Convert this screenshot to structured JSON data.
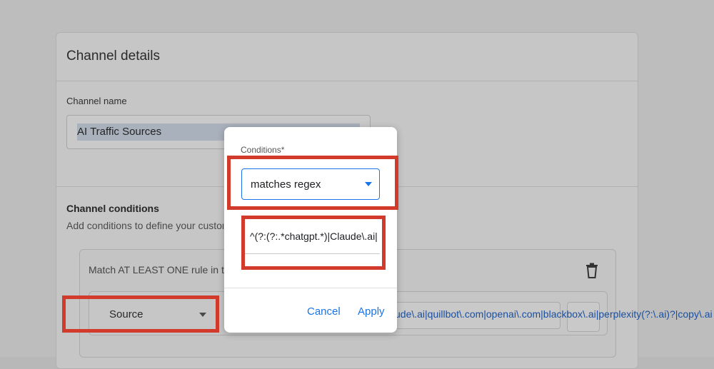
{
  "channel_details": {
    "title": "Channel details",
    "name_label": "Channel name",
    "name_value": "AI Traffic Sources",
    "conditions_heading": "Channel conditions",
    "conditions_hint": "Add conditions to define your custom channel.",
    "rule_group_text": "Match AT LEAST ONE rule in this group",
    "dimension": "Source",
    "regex_overflow": "ude\\.ai|quillbot\\.com|openai\\.com|blackbox\\.ai|perplexity(?:\\.ai)?|copy\\.ai"
  },
  "dialog": {
    "label": "Conditions*",
    "operator": "matches regex",
    "regex_value": "^(?:(?:.*chatgpt.*)|Claude\\.ai|",
    "cancel_label": "Cancel",
    "apply_label": "Apply"
  },
  "colors": {
    "accent": "#1a73e8",
    "highlight": "#d23b2b"
  },
  "icons": [
    "trash-icon",
    "dropdown-caret-icon",
    "clear-icon"
  ]
}
